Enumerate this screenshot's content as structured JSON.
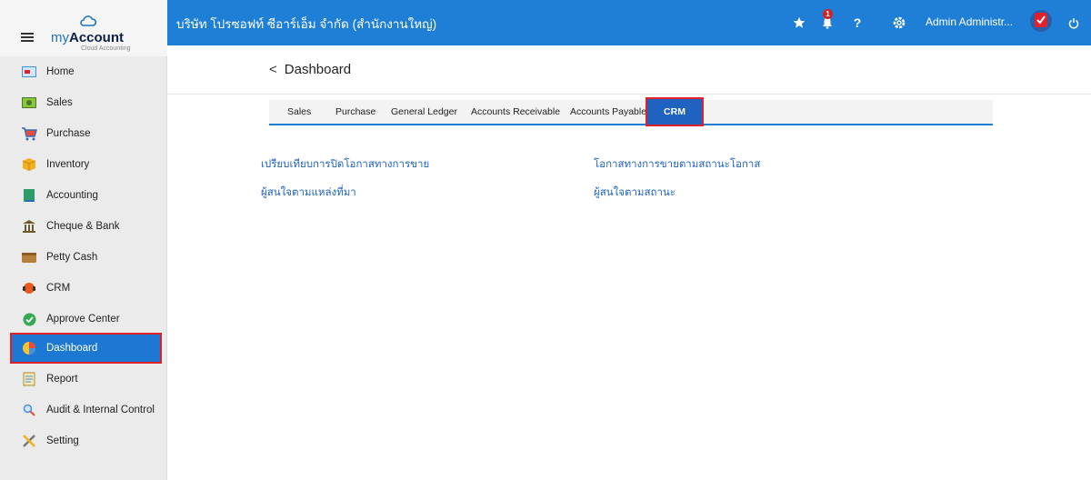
{
  "app": {
    "logo_text": "myAccount",
    "logo_prefix": "my",
    "logo_suffix": "Account",
    "logo_tagline": "Cloud Accounting"
  },
  "topbar": {
    "company": "บริษัท โปรซอฟท์ ซีอาร์เอ็ม จำกัด (สำนักงานใหญ่)",
    "notification_count": "1",
    "help_label": "?",
    "user_name": "Admin Administr...",
    "colors": {
      "bar": "#1f7fd6",
      "badge": "#d92020"
    }
  },
  "sidebar": {
    "items": [
      {
        "label": "Home",
        "icon": "home-icon"
      },
      {
        "label": "Sales",
        "icon": "sales-icon"
      },
      {
        "label": "Purchase",
        "icon": "cart-icon"
      },
      {
        "label": "Inventory",
        "icon": "box-icon"
      },
      {
        "label": "Accounting",
        "icon": "book-icon"
      },
      {
        "label": "Cheque & Bank",
        "icon": "bank-icon"
      },
      {
        "label": "Petty Cash",
        "icon": "wallet-icon"
      },
      {
        "label": "CRM",
        "icon": "crm-icon"
      },
      {
        "label": "Approve Center",
        "icon": "check-circle-icon"
      },
      {
        "label": "Dashboard",
        "icon": "pie-chart-icon",
        "active": true
      },
      {
        "label": "Report",
        "icon": "report-icon"
      },
      {
        "label": "Audit & Internal Control",
        "icon": "magnifier-icon"
      },
      {
        "label": "Setting",
        "icon": "tools-icon"
      }
    ],
    "active_color": "#1c78d2"
  },
  "main": {
    "back_label": "<",
    "title": "Dashboard",
    "tabs": [
      {
        "label": "Sales"
      },
      {
        "label": "Purchase"
      },
      {
        "label": "General Ledger"
      },
      {
        "label": "Accounts Receivable"
      },
      {
        "label": "Accounts Payable"
      },
      {
        "label": "CRM",
        "active": true
      }
    ],
    "links": [
      {
        "label": "เปรียบเทียบการปิดโอกาสทางการขาย"
      },
      {
        "label": "โอกาสทางการขายตามสถานะโอกาส"
      },
      {
        "label": "ผู้สนใจตามแหล่งที่มา"
      },
      {
        "label": "ผู้สนใจตามสถานะ"
      }
    ]
  }
}
